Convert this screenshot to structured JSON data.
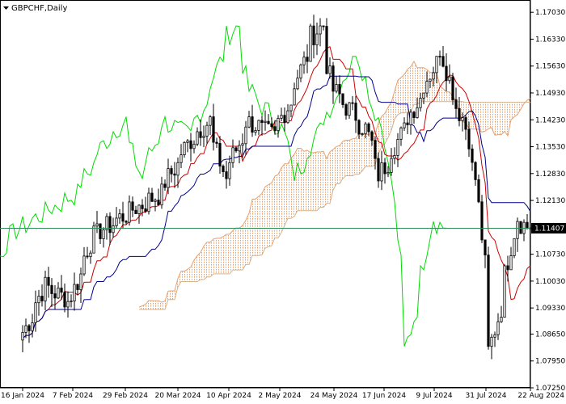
{
  "window": {
    "symbol_label": "GBPCHF,Daily"
  },
  "current_price_label": "1.11407",
  "colors": {
    "background": "#ffffff",
    "candle_bull_body": "#ffffff",
    "candle_bear_body": "#000000",
    "candle_wick": "#000000",
    "tenkan": "#cc0000",
    "kijun": "#00008b",
    "chikou": "#00dd00",
    "cloud_dots": "#e8a070",
    "current_price_line": "#2e8b57",
    "axis": "#000000"
  },
  "chart_data": {
    "type": "candlestick",
    "instrument": "GBPCHF",
    "timeframe": "Daily",
    "indicator": "Ichimoku Kinko Hyo",
    "ylim": [
      1.0725,
      1.1735
    ],
    "y_ticks": [
      "1.17030",
      "1.16330",
      "1.15630",
      "1.14930",
      "1.14230",
      "1.13530",
      "1.12830",
      "1.12130",
      "1.11407",
      "1.10730",
      "1.10030",
      "1.09330",
      "1.08650",
      "1.07950",
      "1.07250"
    ],
    "x_ticks": [
      "16 Jan 2024",
      "7 Feb 2024",
      "29 Feb 2024",
      "20 Mar 2024",
      "10 Apr 2024",
      "2 May 2024",
      "24 May 2024",
      "17 Jun 2024",
      "9 Jul 2024",
      "31 Jul 2024",
      "22 Aug 2024"
    ],
    "last_price": 1.11407,
    "price_anchors": [
      {
        "date": "2024-01-16",
        "close": 1.087
      },
      {
        "date": "2024-01-25",
        "close": 1.099
      },
      {
        "date": "2024-02-05",
        "close": 1.095
      },
      {
        "date": "2024-02-15",
        "close": 1.112
      },
      {
        "date": "2024-03-01",
        "close": 1.118
      },
      {
        "date": "2024-03-15",
        "close": 1.123
      },
      {
        "date": "2024-03-28",
        "close": 1.137
      },
      {
        "date": "2024-04-05",
        "close": 1.142
      },
      {
        "date": "2024-04-12",
        "close": 1.127
      },
      {
        "date": "2024-04-22",
        "close": 1.142
      },
      {
        "date": "2024-05-03",
        "close": 1.138
      },
      {
        "date": "2024-05-10",
        "close": 1.147
      },
      {
        "date": "2024-05-20",
        "close": 1.164
      },
      {
        "date": "2024-05-24",
        "close": 1.167
      },
      {
        "date": "2024-05-29",
        "close": 1.15
      },
      {
        "date": "2024-06-05",
        "close": 1.145
      },
      {
        "date": "2024-06-12",
        "close": 1.14
      },
      {
        "date": "2024-06-18",
        "close": 1.128
      },
      {
        "date": "2024-06-26",
        "close": 1.137
      },
      {
        "date": "2024-07-05",
        "close": 1.148
      },
      {
        "date": "2024-07-15",
        "close": 1.161
      },
      {
        "date": "2024-07-19",
        "close": 1.15
      },
      {
        "date": "2024-07-24",
        "close": 1.143
      },
      {
        "date": "2024-07-30",
        "close": 1.127
      },
      {
        "date": "2024-08-05",
        "close": 1.082
      },
      {
        "date": "2024-08-12",
        "close": 1.102
      },
      {
        "date": "2024-08-16",
        "close": 1.117
      },
      {
        "date": "2024-08-22",
        "close": 1.114
      }
    ]
  }
}
